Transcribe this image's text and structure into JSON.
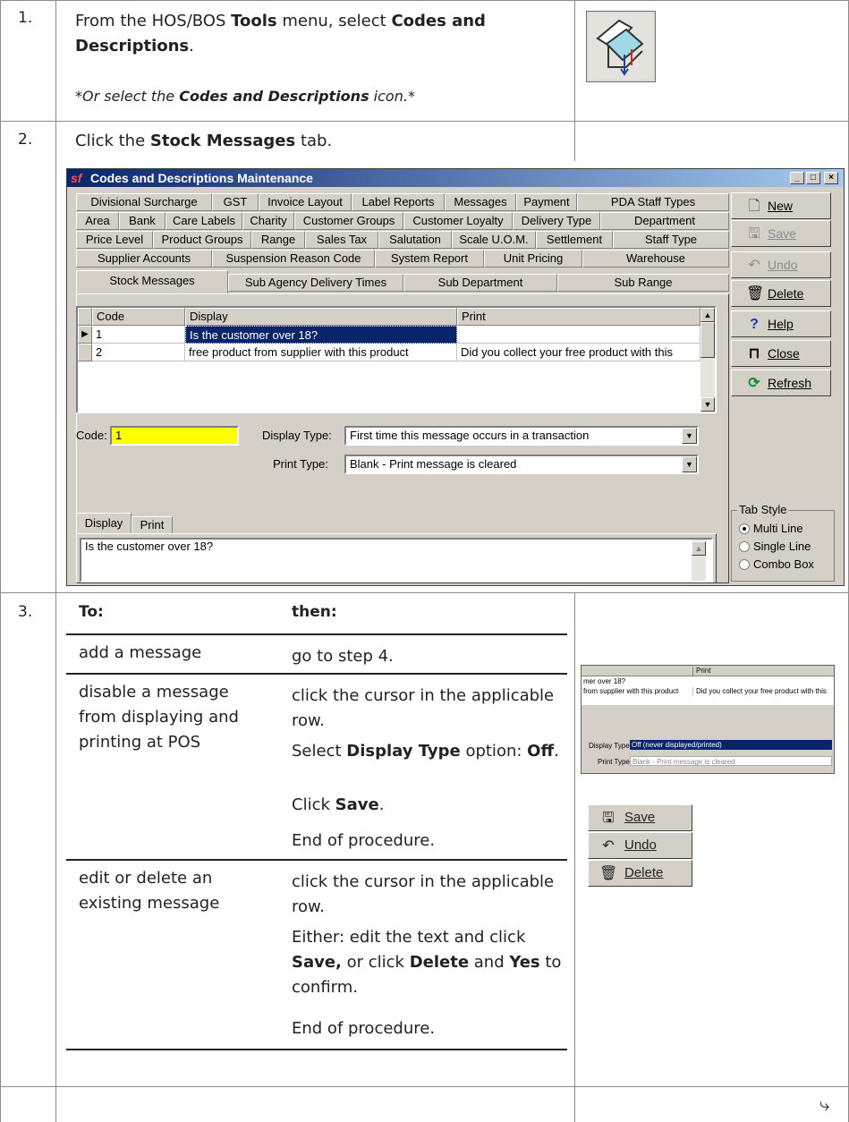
{
  "step1": {
    "number": "1.",
    "pre": "From the HOS/BOS ",
    "tools": "Tools",
    "mid": " menu, select ",
    "codes": "Codes and Descriptions",
    "end": ".",
    "note_pre": "*Or select the ",
    "note_bold": "Codes and Descriptions",
    "note_post": " icon.*",
    "icon": "codes-and-descriptions-icon"
  },
  "step2": {
    "number": "2.",
    "pre": "Click the ",
    "bold": "Stock Messages",
    "post": " tab."
  },
  "window": {
    "title": "Codes and Descriptions Maintenance",
    "app_icon": "sf",
    "controls": [
      "_",
      "□",
      "×"
    ],
    "tab_rows": [
      [
        "Divisional Surcharge",
        "GST",
        "Invoice Layout",
        "Label Reports",
        "Messages",
        "Payment",
        "PDA Staff Types"
      ],
      [
        "Area",
        "Bank",
        "Care Labels",
        "Charity",
        "Customer Groups",
        "Customer Loyalty",
        "Delivery Type",
        "Department"
      ],
      [
        "Price Level",
        "Product Groups",
        "Range",
        "Sales Tax",
        "Salutation",
        "Scale U.O.M.",
        "Settlement",
        "Staff Type"
      ],
      [
        "Supplier Accounts",
        "Suspension Reason Code",
        "System Report",
        "Unit Pricing",
        "Warehouse"
      ],
      [
        "Stock Messages",
        "Sub Agency Delivery Times",
        "Sub Department",
        "Sub Range"
      ]
    ],
    "grid": {
      "headers": [
        "Code",
        "Display",
        "Print"
      ],
      "rows": [
        [
          "1",
          "Is the customer over 18?",
          ""
        ],
        [
          "2",
          "free product from supplier with this product",
          "Did you collect your free product with this"
        ]
      ]
    },
    "code_label": "Code:",
    "code_value": "1",
    "display_type_label": "Display Type:",
    "display_type_value": "First time this message occurs in a transaction",
    "print_type_label": "Print Type:",
    "print_type_value": "Blank - Print message is cleared",
    "subtabs": [
      "Display",
      "Print"
    ],
    "memo_text": "Is the customer over 18?",
    "buttons": {
      "new": "New",
      "save": "Save",
      "undo": "Undo",
      "delete": "Delete",
      "help": "Help",
      "close": "Close",
      "refresh": "Refresh"
    },
    "tab_style": {
      "legend": "Tab Style",
      "options": [
        "Multi Line",
        "Single Line",
        "Combo Box"
      ],
      "selected": "Multi Line"
    }
  },
  "step3": {
    "number": "3.",
    "col_to": "To:",
    "col_then": "then:",
    "rows": [
      {
        "to": "add a message",
        "then": [
          "go to step 4."
        ]
      },
      {
        "to": "disable a message from displaying and printing at POS",
        "then_1": "click the cursor in the applicable row.",
        "then_2_pre": "Select ",
        "then_2_bold": "Display Type",
        "then_2_mid": " option: ",
        "then_2_bold2": "Off",
        "then_2_end": ".",
        "then_3_pre": "Click ",
        "then_3_bold": "Save",
        "then_3_end": ".",
        "then_4": "End of procedure."
      },
      {
        "to": "edit or delete an existing message",
        "then_1": "click the cursor in the applicable row.",
        "then_2_a": "Either: edit the text and click ",
        "then_2_save": "Save,",
        "then_2_b": " or click ",
        "then_2_delete": "Delete",
        "then_2_c": " and ",
        "then_2_yes": "Yes",
        "then_2_d": " to confirm.",
        "then_3": "End of procedure."
      }
    ],
    "mini": {
      "print_header": "Print",
      "row1": "mer over 18?",
      "row2a": "from supplier with this product",
      "row2b": "Did you collect your free product with this",
      "display_type_label": "Display Type:",
      "display_type_value": "Off (never displayed/printed)",
      "print_type_label": "Print Type:",
      "print_type_value": "Blank - Print message is cleared"
    },
    "mini_buttons": {
      "save": "Save",
      "undo": "Undo",
      "delete": "Delete"
    }
  },
  "footer_icon": "continue-arrow-icon"
}
